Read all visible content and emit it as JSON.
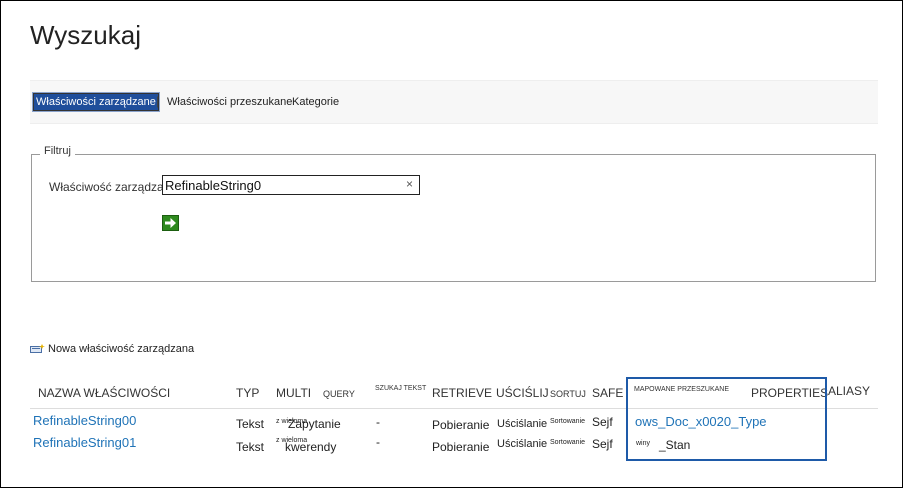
{
  "page": {
    "title": "Wyszukaj"
  },
  "tabs": [
    {
      "label": "Właściwości zarządzane",
      "active": true
    },
    {
      "label": "Właściwości przeszukane",
      "active": false
    },
    {
      "label": "Kategorie",
      "active": false
    }
  ],
  "tab_separators": [
    "|",
    "|"
  ],
  "filter": {
    "legend": "Filtruj",
    "property_label": "Właściwość zarządzana",
    "value": "RefinableString0",
    "clear_symbol": "×"
  },
  "new_property_label": "Nowa właściwość zarządzana",
  "table": {
    "headers": {
      "name": "NAZWA WŁAŚCIWOŚCI",
      "type": "TYP",
      "multi": "MULTI",
      "query": "QUERY",
      "search_text": "SZUKAJ TEKST",
      "retrieve": "RETRIEVE",
      "refine": "UŚCIŚLIJ",
      "sort": "SORTUJ",
      "safe": "SAFE",
      "mapped_crawled": "MAPOWANE PRZESZUKANE",
      "properties": "PROPERTIES",
      "aliases": "ALIASY"
    },
    "rows": [
      {
        "name": "RefinableString00",
        "type": "Tekst",
        "multi_small": "z wieloma",
        "multi_big": "Zapytanie",
        "search": "-",
        "retrieve": "Pobieranie",
        "refine": "Uściślanie",
        "sort": "Sortowanie",
        "safe": "Sejf",
        "mapped": "ows_Doc_x0020_Type"
      },
      {
        "name": "RefinableString01",
        "type": "Tekst",
        "multi_small": "z wieloma",
        "multi_big": "kwerendy",
        "search": "-",
        "retrieve": "Pobieranie",
        "refine": "Uściślanie",
        "sort": "Sortowanie",
        "safe": "Sejf",
        "mapped_small": "winy",
        "mapped": "_Stan"
      }
    ]
  },
  "colors": {
    "accent_tab": "#1f4e9b",
    "link": "#1f73b7",
    "highlight_box": "#1e5aa8",
    "go_button": "#2e8a1e"
  }
}
